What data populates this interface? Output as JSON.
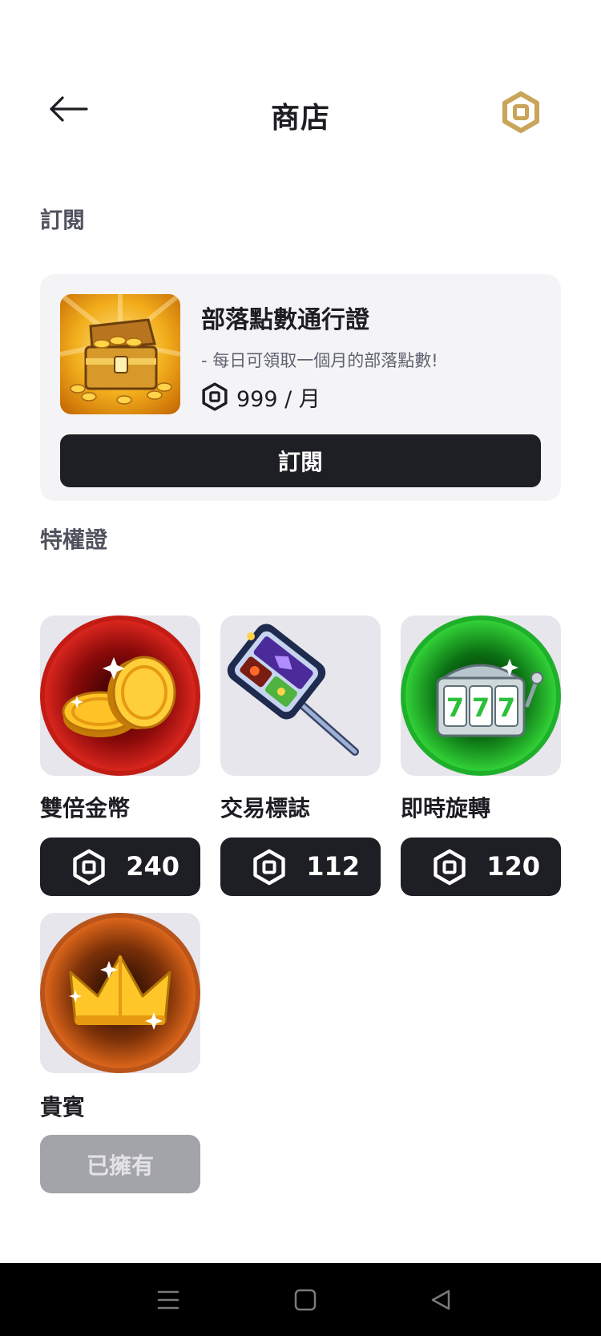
{
  "header": {
    "title": "商店",
    "back_icon": "arrow-left-icon",
    "currency_icon": "robux-gold-icon",
    "currency_icon_color": "#c9a55a"
  },
  "subscriptions": {
    "section_title": "訂閱",
    "item": {
      "name": "部落點數通行證",
      "description": "- 每日可領取一個月的部落點數!",
      "price": "999 / 月",
      "currency_icon": "robux-icon",
      "button_label": "訂閱",
      "thumbnail_icon": "treasure-chest-icon"
    }
  },
  "passes": {
    "section_title": "特權證",
    "items": [
      {
        "name": "雙倍金幣",
        "price": "240",
        "icon": "gold-coins-icon",
        "owned": false
      },
      {
        "name": "交易標誌",
        "price": "112",
        "icon": "trade-sign-icon",
        "owned": false
      },
      {
        "name": "即時旋轉",
        "price": "120",
        "icon": "slot-machine-icon",
        "owned": false
      },
      {
        "name": "貴賓",
        "price": "",
        "owned_label": "已擁有",
        "icon": "crown-icon",
        "owned": true
      }
    ]
  },
  "colors": {
    "button_dark": "#1e1f25",
    "card_bg": "#f4f4f6",
    "owned_button": "#a3a4a9",
    "section_title": "#50535e"
  },
  "system_nav": {
    "menu_icon": "menu-icon",
    "home_icon": "home-square-icon",
    "back_icon": "back-triangle-icon"
  }
}
